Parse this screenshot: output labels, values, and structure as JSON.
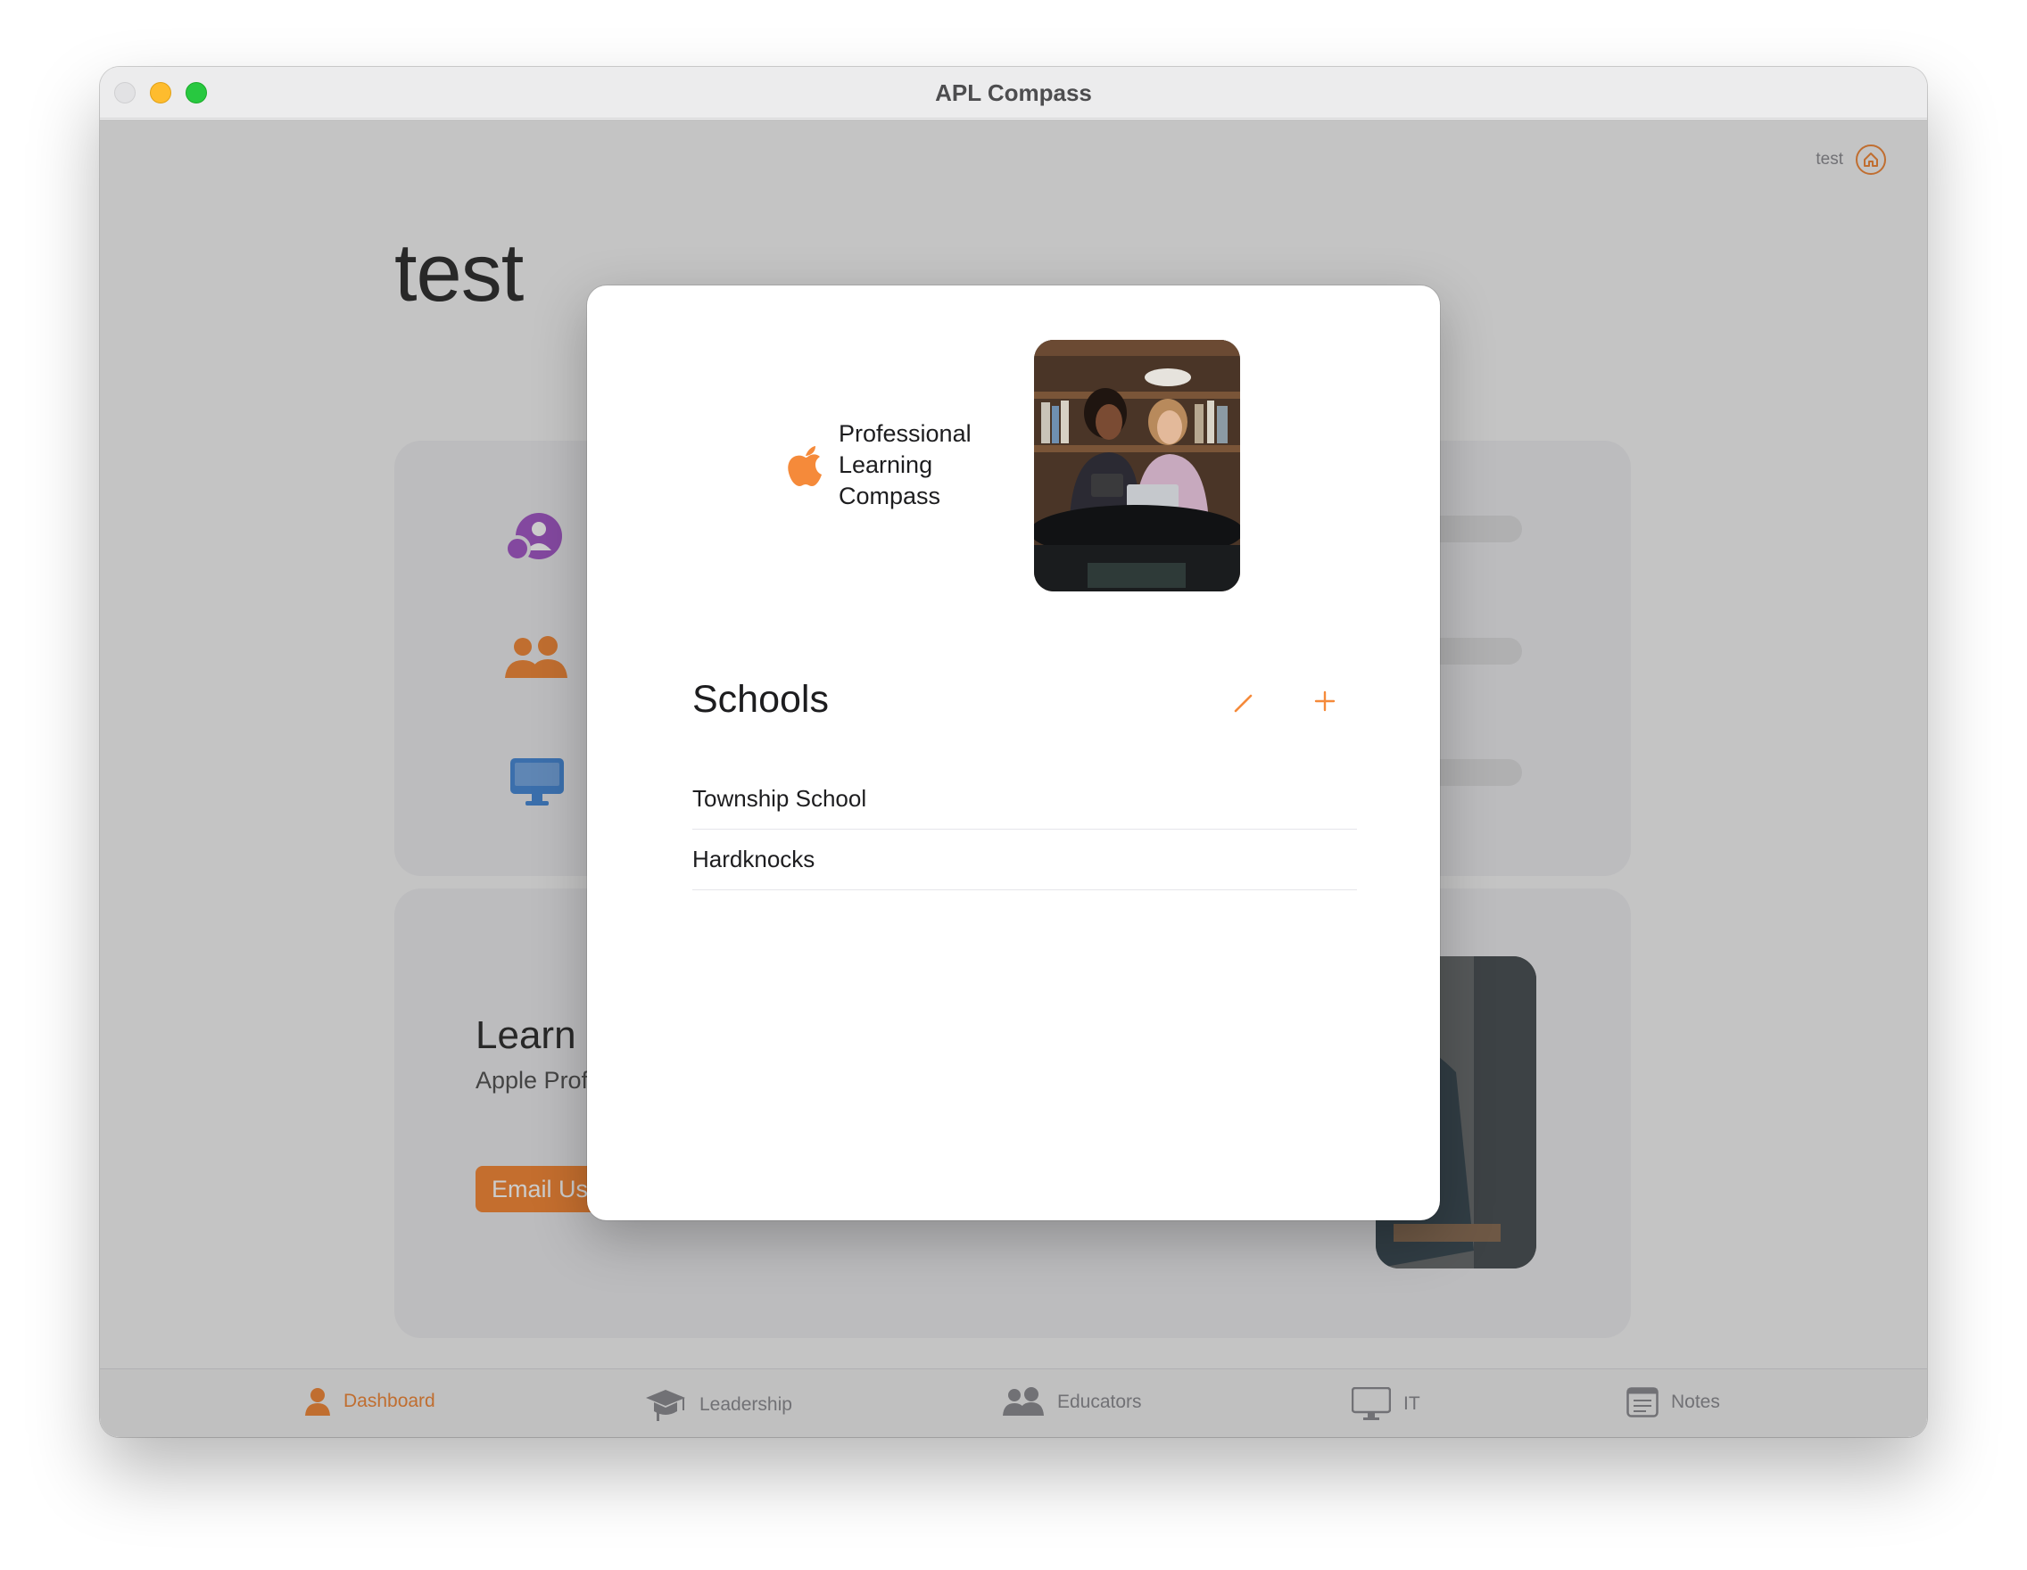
{
  "window": {
    "title": "APL Compass"
  },
  "header": {
    "account_name": "test",
    "page_title": "test"
  },
  "learn_card": {
    "title": "Learn M",
    "body": "Apple Prof leaders, ed students in",
    "button_label": "Email Us"
  },
  "tabs": [
    {
      "label": "Dashboard",
      "icon": "person-icon",
      "active": true
    },
    {
      "label": "Leadership",
      "icon": "graduation-cap-icon",
      "active": false
    },
    {
      "label": "Educators",
      "icon": "people-icon",
      "active": false
    },
    {
      "label": "IT",
      "icon": "desktop-icon",
      "active": false
    },
    {
      "label": "Notes",
      "icon": "notes-icon",
      "active": false
    }
  ],
  "sheet": {
    "brand_line_1": "Professional",
    "brand_line_2": "Learning",
    "brand_line_3": "Compass",
    "schools_title": "Schools",
    "schools": [
      {
        "name": "Township School"
      },
      {
        "name": "Hardknocks"
      }
    ]
  },
  "colors": {
    "accent": "#f58a3a",
    "purple": "#a45bc7",
    "blue": "#4a8bd8"
  }
}
